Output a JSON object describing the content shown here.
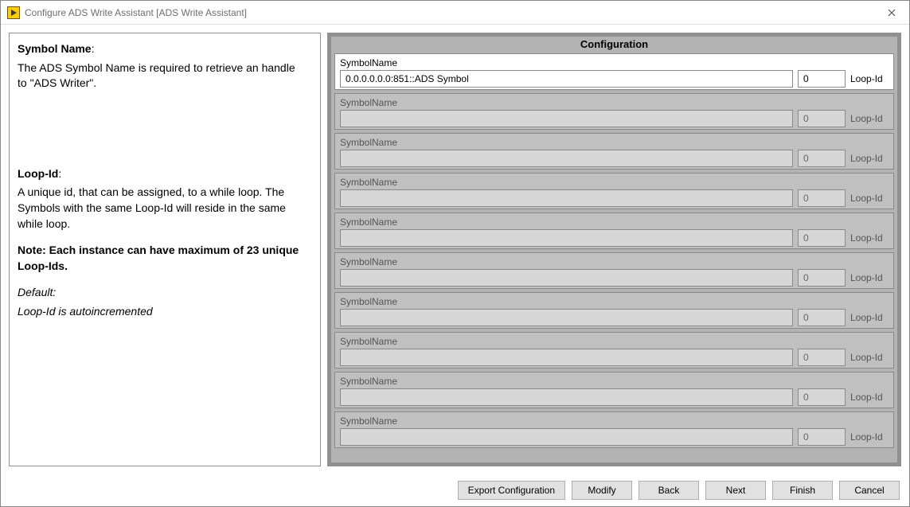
{
  "window": {
    "title": "Configure ADS Write Assistant [ADS Write Assistant]",
    "icon": "labview-play-icon"
  },
  "help": {
    "symbol_name_hdr": "Symbol Name",
    "symbol_name_body": "The ADS Symbol Name is required to retrieve an handle to \"ADS Writer\".",
    "loopid_hdr": "Loop-Id",
    "loopid_body": "A unique id, that can be assigned, to a while loop. The Symbols with the same Loop-Id will reside in the same while loop.",
    "note": "Note: Each instance can have maximum of 23 unique Loop-Ids.",
    "default_hdr": "Default:",
    "default_body": "Loop-Id is autoincremented"
  },
  "config": {
    "title": "Configuration",
    "row_label": "SymbolName",
    "loop_label": "Loop-Id",
    "rows": [
      {
        "symbol": "0.0.0.0.0.0:851::ADS Symbol",
        "loopid": "0",
        "active": true
      },
      {
        "symbol": "",
        "loopid": "0",
        "active": false
      },
      {
        "symbol": "",
        "loopid": "0",
        "active": false
      },
      {
        "symbol": "",
        "loopid": "0",
        "active": false
      },
      {
        "symbol": "",
        "loopid": "0",
        "active": false
      },
      {
        "symbol": "",
        "loopid": "0",
        "active": false
      },
      {
        "symbol": "",
        "loopid": "0",
        "active": false
      },
      {
        "symbol": "",
        "loopid": "0",
        "active": false
      },
      {
        "symbol": "",
        "loopid": "0",
        "active": false
      },
      {
        "symbol": "",
        "loopid": "0",
        "active": false
      }
    ]
  },
  "buttons": {
    "export": "Export Configuration",
    "modify": "Modify",
    "back": "Back",
    "next": "Next",
    "finish": "Finish",
    "cancel": "Cancel"
  }
}
